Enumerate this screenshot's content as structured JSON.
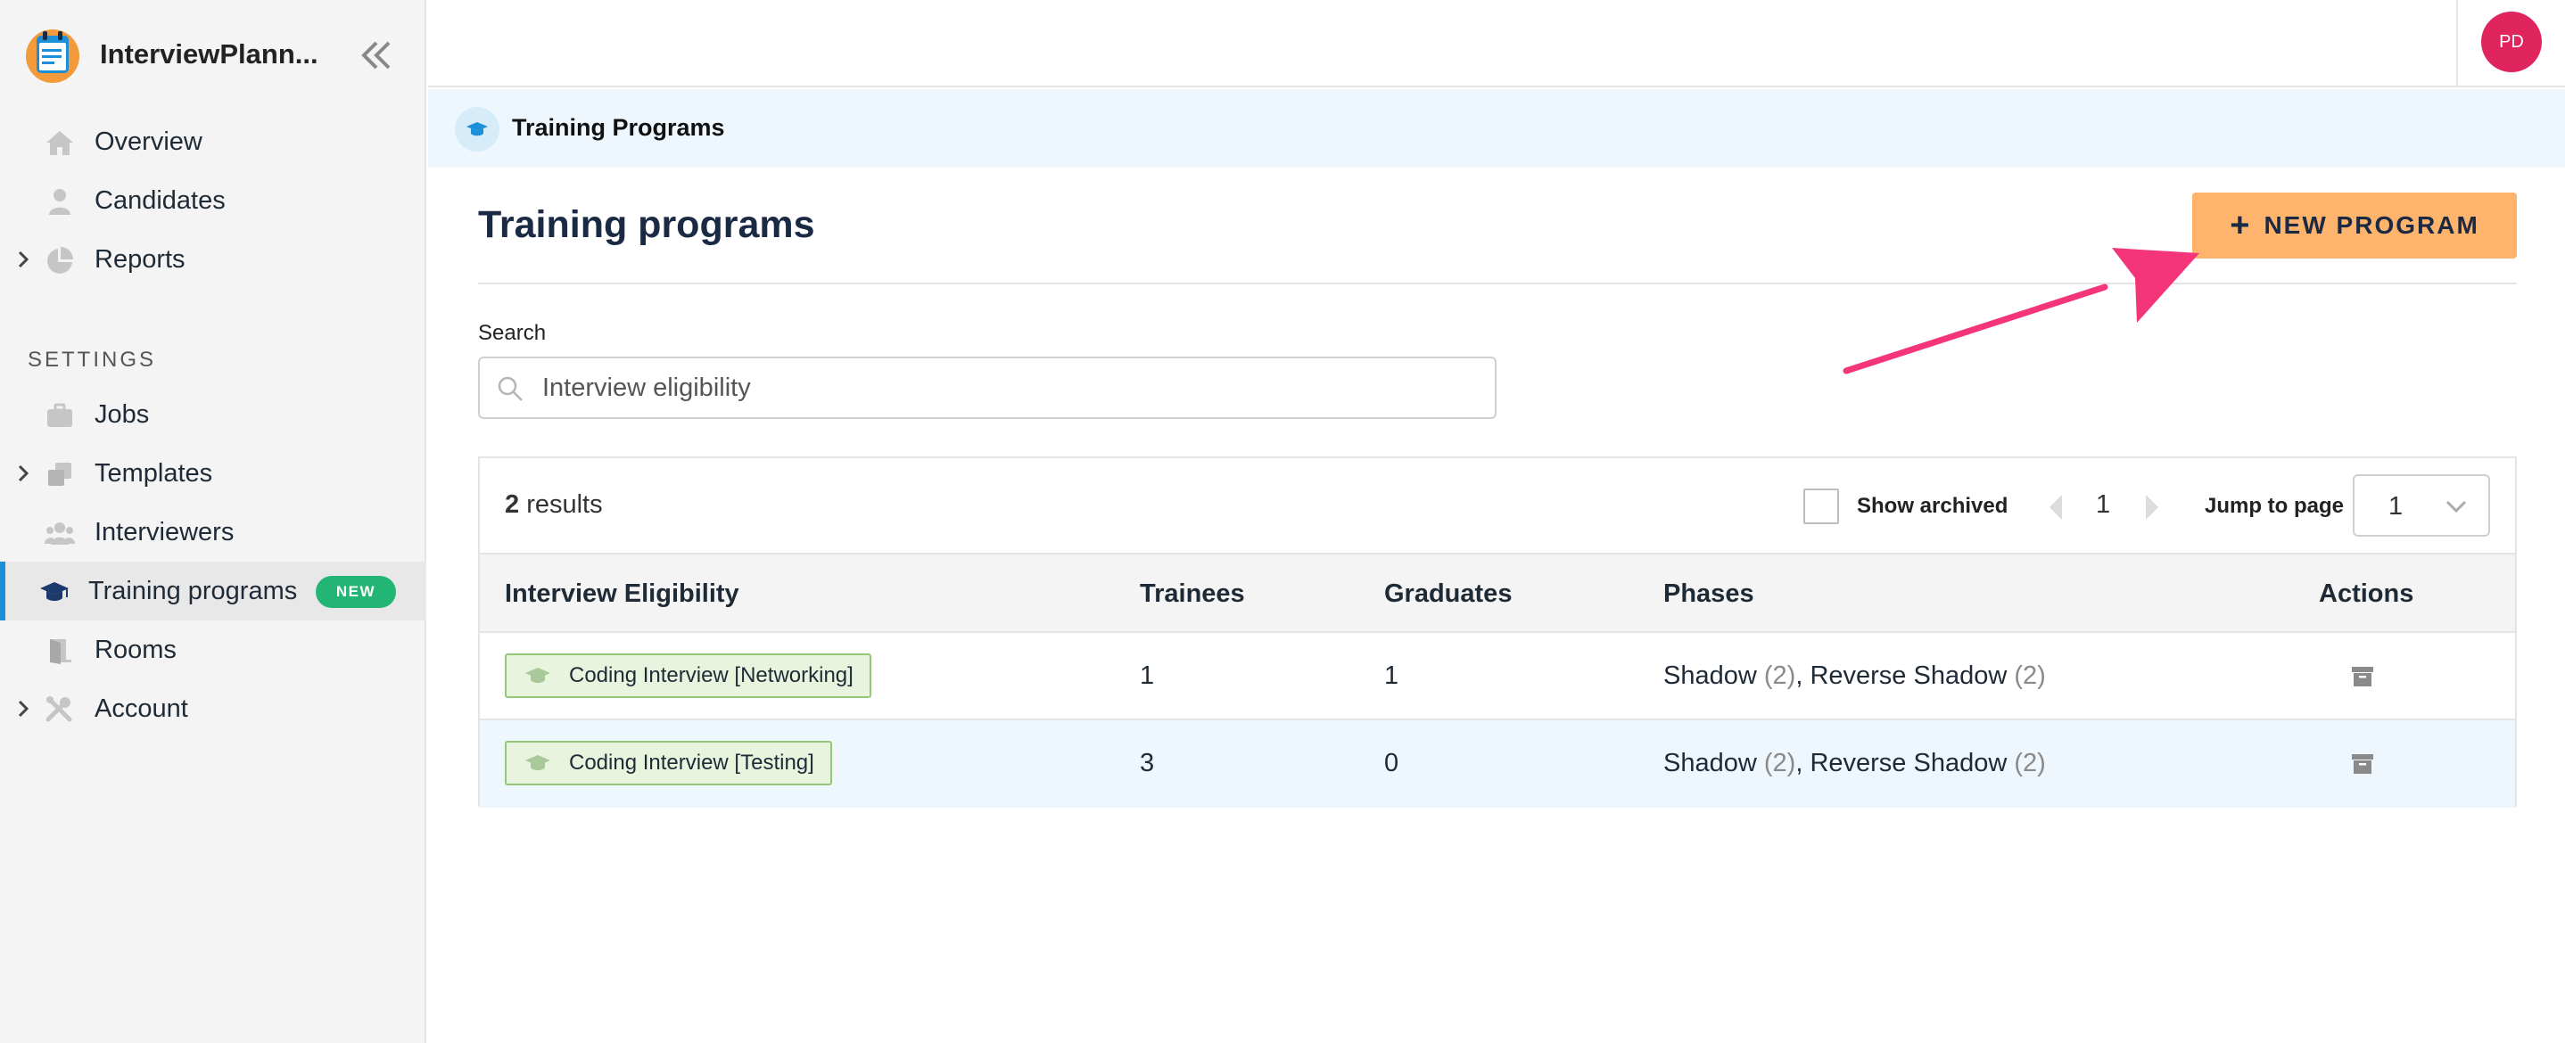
{
  "app": {
    "name": "InterviewPlann..."
  },
  "sidebar": {
    "items": [
      {
        "label": "Overview",
        "icon": "home-icon"
      },
      {
        "label": "Candidates",
        "icon": "person-icon"
      },
      {
        "label": "Reports",
        "icon": "pie-chart-icon",
        "expandable": true
      }
    ],
    "settings_heading": "SETTINGS",
    "settings_items": [
      {
        "label": "Jobs",
        "icon": "briefcase-icon"
      },
      {
        "label": "Templates",
        "icon": "copy-icon",
        "expandable": true
      },
      {
        "label": "Interviewers",
        "icon": "users-icon"
      },
      {
        "label": "Training programs",
        "icon": "graduation-cap-icon",
        "active": true,
        "badge": "NEW"
      },
      {
        "label": "Rooms",
        "icon": "door-icon"
      },
      {
        "label": "Account",
        "icon": "tools-icon",
        "expandable": true
      }
    ]
  },
  "header": {
    "avatar_initials": "PD"
  },
  "breadcrumb": {
    "label": "Training Programs"
  },
  "main": {
    "title": "Training programs",
    "new_button_label": "NEW PROGRAM",
    "search": {
      "label": "Search",
      "value": "Interview eligibility"
    },
    "results": {
      "count": "2",
      "suffix": "results"
    },
    "show_archived_label": "Show archived",
    "page_number": "1",
    "jump_label": "Jump to page",
    "jump_value": "1",
    "columns": [
      "Interview Eligibility",
      "Trainees",
      "Graduates",
      "Phases",
      "Actions"
    ],
    "rows": [
      {
        "eligibility": "Coding Interview [Networking]",
        "trainees": "1",
        "graduates": "1",
        "phase1": "Shadow",
        "phase1_count": "(2)",
        "sep": ",",
        "phase2": "Reverse Shadow",
        "phase2_count": "(2)"
      },
      {
        "eligibility": "Coding Interview [Testing]",
        "trainees": "3",
        "graduates": "0",
        "phase1": "Shadow",
        "phase1_count": "(2)",
        "sep": ",",
        "phase2": "Reverse Shadow",
        "phase2_count": "(2)"
      }
    ]
  },
  "colors": {
    "accent": "#ffb46e",
    "active_bar": "#1d8fd8",
    "badge_green": "#22b573",
    "avatar": "#e0245e",
    "annotation_arrow": "#f5357a"
  }
}
